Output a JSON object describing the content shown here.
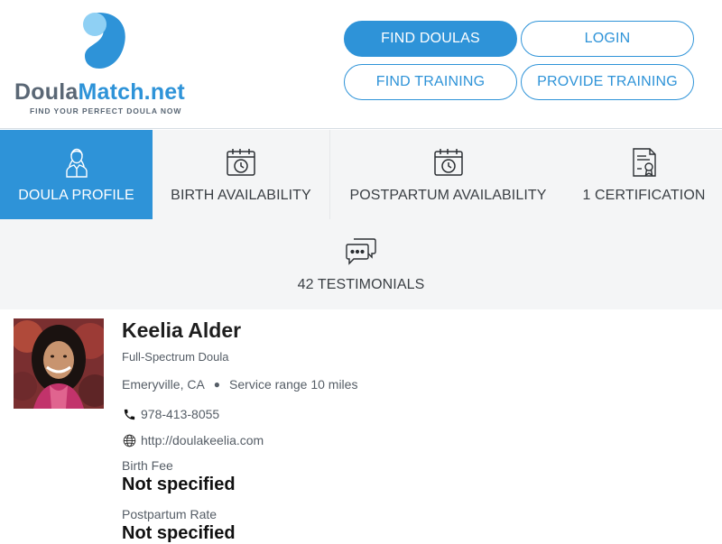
{
  "brand": {
    "name_part1": "Doula",
    "name_part2": "Match.net",
    "tagline": "FIND YOUR PERFECT DOULA NOW",
    "primary_color": "#2e93d8",
    "secondary_color": "#5a6775"
  },
  "nav": {
    "find_doulas": "FIND DOULAS",
    "login": "LOGIN",
    "find_training": "FIND TRAINING",
    "provide_training": "PROVIDE TRAINING"
  },
  "tabs": [
    {
      "label": "DOULA PROFILE",
      "icon": "person-icon",
      "active": true
    },
    {
      "label": "BIRTH AVAILABILITY",
      "icon": "calendar-clock-icon",
      "active": false
    },
    {
      "label": "POSTPARTUM AVAILABILITY",
      "icon": "calendar-clock-icon",
      "active": false
    },
    {
      "label": "1 CERTIFICATION",
      "icon": "certificate-icon",
      "active": false
    },
    {
      "label": "42 TESTIMONIALS",
      "icon": "chat-bubbles-icon",
      "active": false
    }
  ],
  "profile": {
    "name": "Keelia Alder",
    "title": "Full-Spectrum Doula",
    "location": "Emeryville, CA",
    "service_range": "Service range 10 miles",
    "phone": "978-413-8055",
    "website": "http://doulakeelia.com",
    "birth_fee_label": "Birth Fee",
    "birth_fee_value": "Not specified",
    "postpartum_rate_label": "Postpartum Rate",
    "postpartum_rate_value": "Not specified"
  }
}
